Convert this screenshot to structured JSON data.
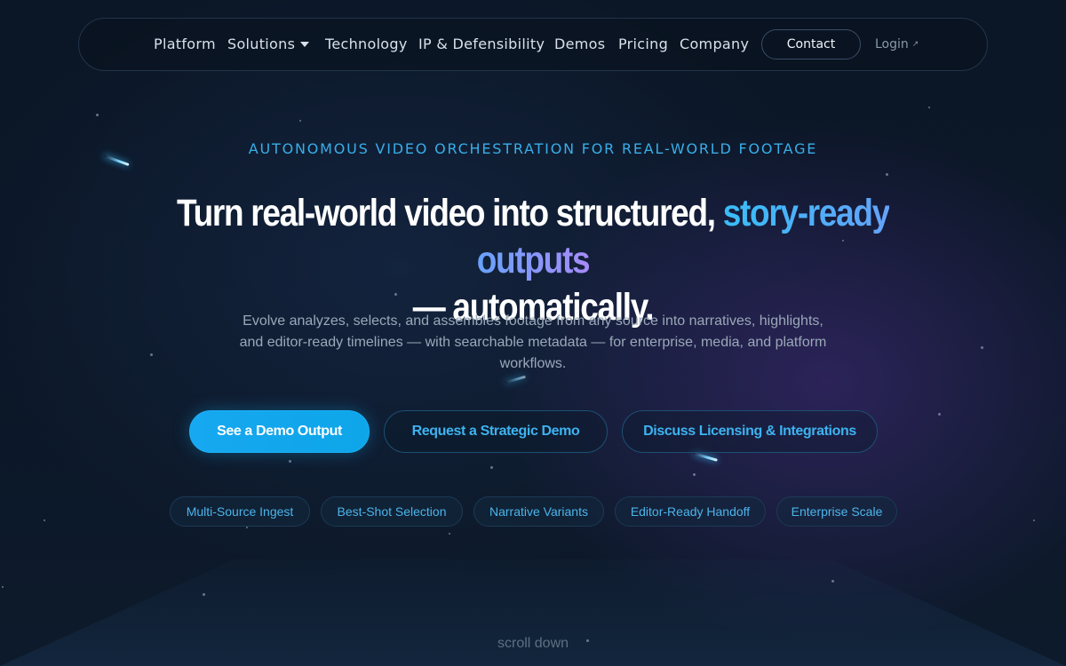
{
  "nav": {
    "items": [
      {
        "label": "Platform"
      },
      {
        "label": "Solutions"
      },
      {
        "label": "Technology"
      },
      {
        "label": "IP & Defensibility"
      },
      {
        "label": "Demos"
      },
      {
        "label": "Pricing"
      },
      {
        "label": "Company"
      }
    ],
    "contact_label": "Contact",
    "login_label": "Login"
  },
  "hero": {
    "eyebrow": "AUTONOMOUS VIDEO ORCHESTRATION FOR REAL-WORLD FOOTAGE",
    "headline_part1": "Turn real-world video into structured, ",
    "headline_highlight": "story-ready outputs",
    "headline_part2": "— automatically.",
    "subtext": "Evolve analyzes, selects, and assembles footage from any source into narratives, highlights, and editor-ready timelines — with searchable metadata — for enterprise, media, and platform workflows.",
    "cta_primary": "See a Demo Output",
    "cta_secondary": "Request a Strategic Demo",
    "cta_tertiary": "Discuss Licensing & Integrations",
    "features": [
      {
        "label": "Multi-Source Ingest"
      },
      {
        "label": "Best-Shot Selection"
      },
      {
        "label": "Narrative Variants"
      },
      {
        "label": "Editor-Ready Handoff"
      },
      {
        "label": "Enterprise Scale"
      }
    ],
    "scroll_label": "scroll down"
  },
  "colors": {
    "accent": "#38bdf8",
    "gradient_end": "#a78bfa",
    "background": "#0b1626"
  }
}
